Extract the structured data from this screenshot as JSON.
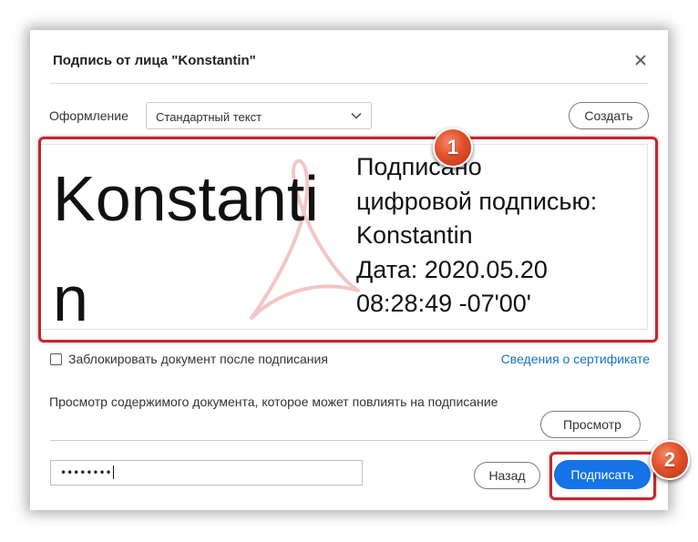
{
  "dialog": {
    "title": "Подпись от лица \"Konstantin\"",
    "close_icon": "close-icon"
  },
  "appearance": {
    "label": "Оформление",
    "selected": "Стандартный текст",
    "create_label": "Создать"
  },
  "preview": {
    "name": "Konstantin",
    "details": "Подписано\nцифровой подписью:\nKonstantin\nДата: 2020.05.20\n08:28:49 -07'00'",
    "watermark_icon": "acrobat-logo-watermark"
  },
  "lock": {
    "label": "Заблокировать документ после подписания",
    "checked": false
  },
  "certificate_link": "Сведения о сертификате",
  "review": {
    "text": "Просмотр содержимого документа, которое может повлиять на подписание",
    "button_label": "Просмотр"
  },
  "password": {
    "value": "••••••••"
  },
  "buttons": {
    "back": "Назад",
    "sign": "Подписать"
  },
  "markers": [
    "1",
    "2"
  ],
  "colors": {
    "accent": "#1473e6",
    "highlight": "#c6262e",
    "link": "#1473c6",
    "marker": "#e1502c"
  }
}
